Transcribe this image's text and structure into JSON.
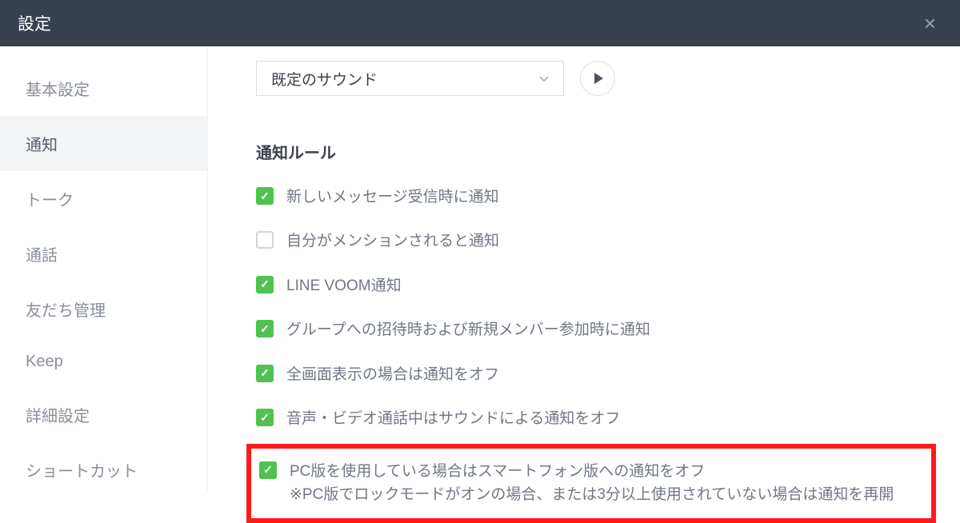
{
  "header": {
    "title": "設定",
    "close": "×"
  },
  "sidebar": {
    "items": [
      {
        "label": "基本設定"
      },
      {
        "label": "通知"
      },
      {
        "label": "トーク"
      },
      {
        "label": "通話"
      },
      {
        "label": "友だち管理"
      },
      {
        "label": "Keep"
      },
      {
        "label": "詳細設定"
      },
      {
        "label": "ショートカット"
      }
    ],
    "activeIndex": 1
  },
  "content": {
    "sound": {
      "selected": "既定のサウンド"
    },
    "section_title": "通知ルール",
    "rules": [
      {
        "checked": true,
        "label": "新しいメッセージ受信時に通知"
      },
      {
        "checked": false,
        "label": "自分がメンションされると通知"
      },
      {
        "checked": true,
        "label": "LINE VOOM通知"
      },
      {
        "checked": true,
        "label": "グループへの招待時および新規メンバー参加時に通知"
      },
      {
        "checked": true,
        "label": "全画面表示の場合は通知をオフ"
      },
      {
        "checked": true,
        "label": "音声・ビデオ通話中はサウンドによる通知をオフ"
      },
      {
        "checked": true,
        "label": "PC版を使用している場合はスマートフォン版への通知をオフ\n※PC版でロックモードがオンの場合、または3分以上使用されていない場合は通知を再開"
      }
    ]
  }
}
